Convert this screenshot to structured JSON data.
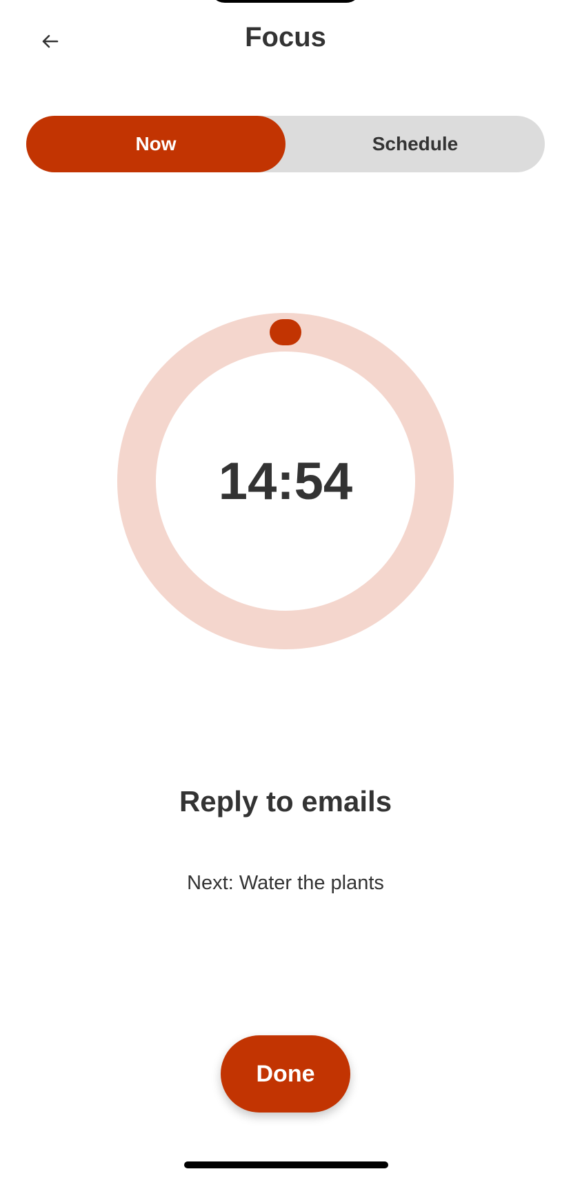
{
  "header": {
    "title": "Focus",
    "back_icon": "arrow-left-icon"
  },
  "segmented_control": {
    "options": [
      {
        "label": "Now",
        "selected": true
      },
      {
        "label": "Schedule",
        "selected": false
      }
    ]
  },
  "timer": {
    "remaining": "14:54",
    "progress_fraction": 0.0
  },
  "task": {
    "current": "Reply to emails",
    "next": "Next: Water the plants"
  },
  "actions": {
    "done_label": "Done"
  },
  "colors": {
    "accent": "#c23402",
    "ring_track": "#f4d6cd",
    "segment_track": "#dcdcdc",
    "text": "#333333"
  }
}
